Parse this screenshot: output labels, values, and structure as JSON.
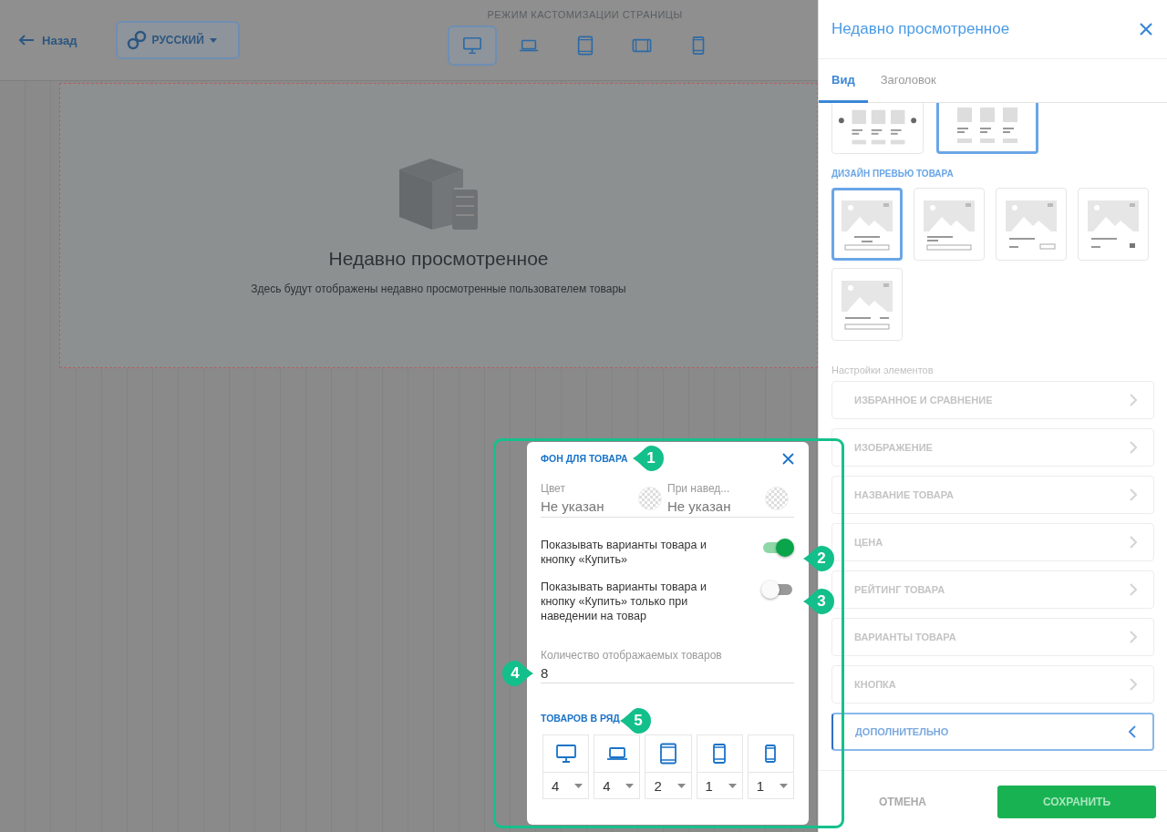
{
  "topbar": {
    "back": "Назад",
    "language": "РУССКИЙ",
    "mode_label": "РЕЖИМ КАСТОМИЗАЦИИ СТРАНИЦЫ",
    "devices": [
      {
        "kind": "desktop",
        "selected": true
      },
      {
        "kind": "laptop",
        "selected": false
      },
      {
        "kind": "tablet",
        "selected": false
      },
      {
        "kind": "tablet-landscape",
        "selected": false
      },
      {
        "kind": "phone",
        "selected": false
      }
    ]
  },
  "canvas": {
    "block_title": "Недавно просмотренное",
    "block_text": "Здесь будут отображены недавно просмотренные пользователем товары"
  },
  "panel": {
    "title": "Недавно просмотренное",
    "tabs": [
      {
        "label": "Вид",
        "selected": true
      },
      {
        "label": "Заголовок",
        "selected": false
      }
    ],
    "layouts": [
      {
        "kind": "carousel",
        "selected": false
      },
      {
        "kind": "grid",
        "selected": true
      }
    ],
    "preview_heading": "ДИЗАЙН ПРЕВЬЮ ТОВАРА",
    "previews": [
      {
        "kind": "centered",
        "selected": true
      },
      {
        "kind": "left",
        "selected": false
      },
      {
        "kind": "price-button",
        "selected": false
      },
      {
        "kind": "price-cart",
        "selected": false
      },
      {
        "kind": "name-price",
        "selected": false
      }
    ],
    "settings_heading": "Настройки элементов",
    "sections": [
      {
        "label": "ИЗБРАННОЕ И СРАВНЕНИЕ",
        "expanded": false
      },
      {
        "label": "ИЗОБРАЖЕНИЕ",
        "expanded": false
      },
      {
        "label": "НАЗВАНИЕ ТОВАРА",
        "expanded": false
      },
      {
        "label": "ЦЕНА",
        "expanded": false
      },
      {
        "label": "РЕЙТИНГ ТОВАРА",
        "expanded": false
      },
      {
        "label": "ВАРИАНТЫ ТОВАРА",
        "expanded": false
      },
      {
        "label": "КНОПКА",
        "expanded": false
      },
      {
        "label": "ДОПОЛНИТЕЛЬНО",
        "expanded": true
      }
    ],
    "cancel": "ОТМЕНА",
    "save": "СОХРАНИТЬ"
  },
  "popup": {
    "title": "ФОН ДЛЯ ТОВАРА",
    "colors": [
      {
        "label": "Цвет",
        "value": "Не указан"
      },
      {
        "label": "При навед...",
        "value": "Не указан"
      }
    ],
    "toggles": [
      {
        "label": "Показывать варианты товара и кнопку «Купить»",
        "on": true
      },
      {
        "label": "Показывать варианты товара и кнопку «Купить» только при наведении на товар",
        "on": false
      }
    ],
    "count": {
      "label": "Количество отображаемых товаров",
      "value": "8"
    },
    "per_row_heading": "ТОВАРОВ В РЯД",
    "per_row": [
      {
        "kind": "desktop",
        "value": "4"
      },
      {
        "kind": "laptop",
        "value": "4"
      },
      {
        "kind": "tablet",
        "value": "2"
      },
      {
        "kind": "phone",
        "value": "1"
      },
      {
        "kind": "phone-small",
        "value": "1"
      }
    ]
  },
  "callouts": [
    "1",
    "2",
    "3",
    "4",
    "5"
  ]
}
